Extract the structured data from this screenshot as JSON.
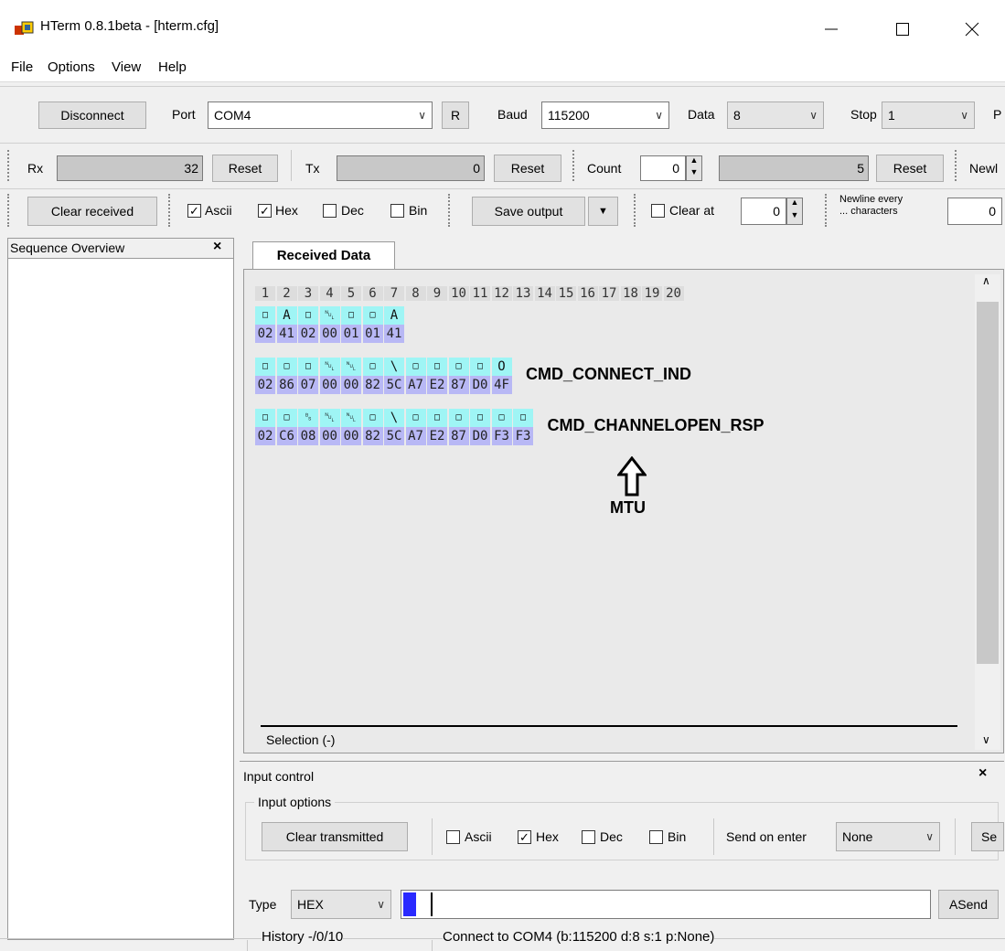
{
  "window": {
    "title": "HTerm 0.8.1beta - [hterm.cfg]"
  },
  "menu": [
    "File",
    "Options",
    "View",
    "Help"
  ],
  "connection": {
    "disconnect_label": "Disconnect",
    "port_label": "Port",
    "port_value": "COM4",
    "r_label": "R",
    "baud_label": "Baud",
    "baud_value": "115200",
    "data_label": "Data",
    "data_value": "8",
    "stop_label": "Stop",
    "stop_value": "1",
    "parity_label_clipped": "P"
  },
  "counters": {
    "rx_label": "Rx",
    "rx_value": "32",
    "rx_reset": "Reset",
    "tx_label": "Tx",
    "tx_value": "0",
    "tx_reset": "Reset",
    "count_label": "Count",
    "count_value": "0",
    "count_bar_value": "5",
    "count_reset": "Reset",
    "newline_clipped": "Newl"
  },
  "display": {
    "clear_received": "Clear received",
    "ascii_label": "Ascii",
    "ascii_checked": true,
    "hex_label": "Hex",
    "hex_checked": true,
    "dec_label": "Dec",
    "dec_checked": false,
    "bin_label": "Bin",
    "bin_checked": false,
    "save_output": "Save output",
    "clear_at_label": "Clear at",
    "clear_at_checked": false,
    "clear_at_value": "0",
    "newline_every_line1": "Newline every",
    "newline_every_line2": "... characters",
    "newline_every_value": "0"
  },
  "sequence_overview": {
    "title": "Sequence Overview",
    "close": "×"
  },
  "received": {
    "tab_label": "Received Data",
    "column_headers": [
      "1",
      "2",
      "3",
      "4",
      "5",
      "6",
      "7",
      "8",
      "9",
      "10",
      "11",
      "12",
      "13",
      "14",
      "15",
      "16",
      "17",
      "18",
      "19",
      "20"
    ],
    "lines": [
      {
        "ascii": [
          "□",
          "A",
          "□",
          "␀",
          "□",
          "□",
          "A"
        ],
        "hex": [
          "02",
          "41",
          "02",
          "00",
          "01",
          "01",
          "41"
        ],
        "annotation": ""
      },
      {
        "ascii": [
          "□",
          "□",
          "□",
          "␀",
          "␀",
          "□",
          "\\",
          "□",
          "□",
          "□",
          "□",
          "O"
        ],
        "hex": [
          "02",
          "86",
          "07",
          "00",
          "00",
          "82",
          "5C",
          "A7",
          "E2",
          "87",
          "D0",
          "4F"
        ],
        "annotation": "CMD_CONNECT_IND"
      },
      {
        "ascii": [
          "□",
          "□",
          "␈",
          "␀",
          "␀",
          "□",
          "\\",
          "□",
          "□",
          "□",
          "□",
          "□",
          "□"
        ],
        "hex": [
          "02",
          "C6",
          "08",
          "00",
          "00",
          "82",
          "5C",
          "A7",
          "E2",
          "87",
          "D0",
          "F3",
          "F3"
        ],
        "annotation": "CMD_CHANNELOPEN_RSP"
      }
    ],
    "mtu_label": "MTU",
    "selection": "Selection (-)"
  },
  "input_control": {
    "title": "Input control",
    "close": "×",
    "options_label": "Input options",
    "clear_transmitted": "Clear transmitted",
    "ascii_label": "Ascii",
    "ascii_checked": false,
    "hex_label": "Hex",
    "hex_checked": true,
    "dec_label": "Dec",
    "dec_checked": false,
    "bin_label": "Bin",
    "bin_checked": false,
    "send_on_enter_label": "Send on enter",
    "send_on_enter_value": "None",
    "send_clipped": "Se",
    "type_label": "Type",
    "type_value": "HEX",
    "asend": "ASend"
  },
  "status": {
    "history": "History -/0/10",
    "connection": "Connect to COM4 (b:115200 d:8 s:1 p:None)"
  },
  "colors": {
    "ascii_cell": "#9ff5f5",
    "hex_cell": "#b8b8f5",
    "input_cursor": "#2a2aff"
  }
}
